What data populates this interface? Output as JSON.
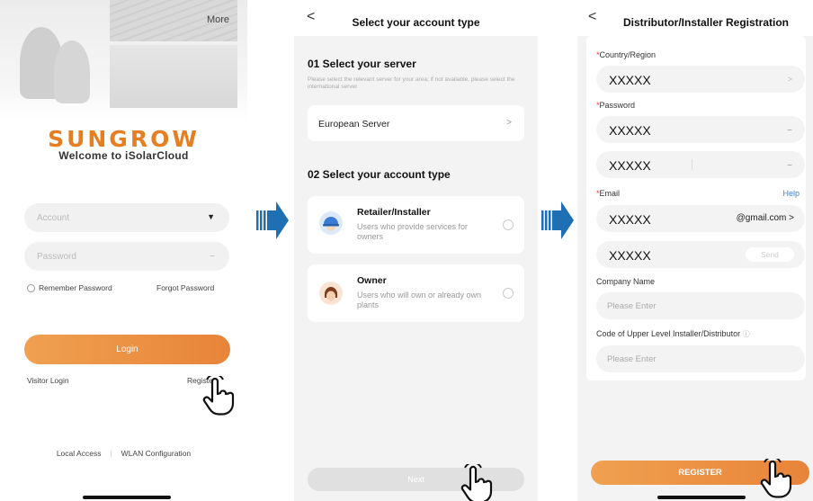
{
  "screen1": {
    "more_label": "More",
    "logo_text": "SUNGROW",
    "welcome": "Welcome to iSolarCloud",
    "account_placeholder": "Account",
    "password_placeholder": "Password",
    "remember": "Remember Password",
    "forgot": "Forgot Password",
    "login": "Login",
    "visitor": "Visitor Login",
    "register": "Register",
    "local_access": "Local Access",
    "separator": "|",
    "wlan": "WLAN Configuration"
  },
  "screen2": {
    "title": "Select your account type",
    "server_heading": "01 Select your server",
    "server_hint": "Please select the relevant server for your area; if not available, please select the international server",
    "server_value": "European Server",
    "type_heading": "02 Select your account type",
    "options": [
      {
        "title": "Retailer/Installer",
        "desc": "Users who provide services for owners"
      },
      {
        "title": "Owner",
        "desc": "Users who will own or already own plants"
      }
    ],
    "next": "Next"
  },
  "screen3": {
    "title": "Distributor/Installer Registration",
    "country_label": "Country/Region",
    "country_value": "XXXXX",
    "password_label": "Password",
    "password_value": "XXXXX",
    "confirm_value": "XXXXX",
    "email_label": "Email",
    "help": "Help",
    "email_value": "XXXXX",
    "email_domain": "@gmail.com",
    "code_value": "XXXXX",
    "send": "Send",
    "company_label": "Company Name",
    "company_placeholder": "Please Enter",
    "code_label": "Code of Upper Level Installer/Distributor",
    "code_placeholder": "Please Enter",
    "register": "REGISTER"
  },
  "colors": {
    "accent": "#E8843A",
    "arrow": "#1F6FB5",
    "link": "#3F7FD9"
  }
}
